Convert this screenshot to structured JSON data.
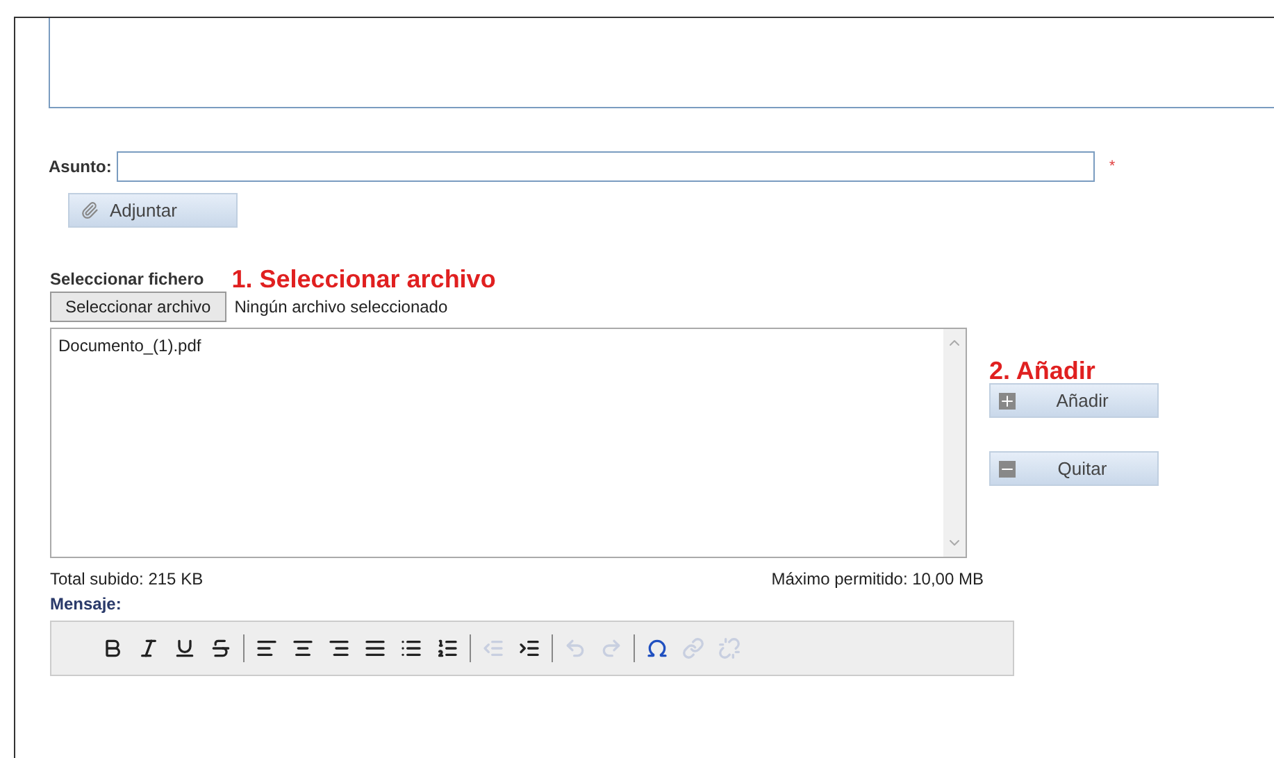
{
  "subject": {
    "label": "Asunto:",
    "required_mark": "*"
  },
  "attach_button": "Adjuntar",
  "file_picker": {
    "label": "Seleccionar fichero",
    "button": "Seleccionar archivo",
    "status": "Ningún archivo seleccionado"
  },
  "annotations": [
    "1. Seleccionar archivo",
    "2. Añadir"
  ],
  "file_list": [
    "Documento_(1).pdf"
  ],
  "actions": [
    {
      "kind": "add",
      "label": "Añadir"
    },
    {
      "kind": "remove",
      "label": "Quitar"
    }
  ],
  "total_uploaded": "Total subido: 215 KB",
  "max_allowed": "Máximo permitido: 10,00 MB",
  "message_label": "Mensaje:",
  "toolbar": [
    [
      {
        "kind": "bold",
        "disabled": false
      },
      {
        "kind": "italic",
        "disabled": false
      },
      {
        "kind": "underline",
        "disabled": false
      },
      {
        "kind": "strike",
        "disabled": false
      }
    ],
    [
      {
        "kind": "align-left",
        "disabled": false
      },
      {
        "kind": "align-center",
        "disabled": false
      },
      {
        "kind": "align-right",
        "disabled": false
      },
      {
        "kind": "justify",
        "disabled": false
      },
      {
        "kind": "bullets",
        "disabled": false
      },
      {
        "kind": "numbers",
        "disabled": false
      }
    ],
    [
      {
        "kind": "outdent",
        "disabled": true
      },
      {
        "kind": "indent",
        "disabled": false
      }
    ],
    [
      {
        "kind": "undo",
        "disabled": true
      },
      {
        "kind": "redo",
        "disabled": true
      }
    ],
    [
      {
        "kind": "omega",
        "disabled": false
      },
      {
        "kind": "link",
        "disabled": true
      },
      {
        "kind": "unlink",
        "disabled": true
      }
    ]
  ]
}
